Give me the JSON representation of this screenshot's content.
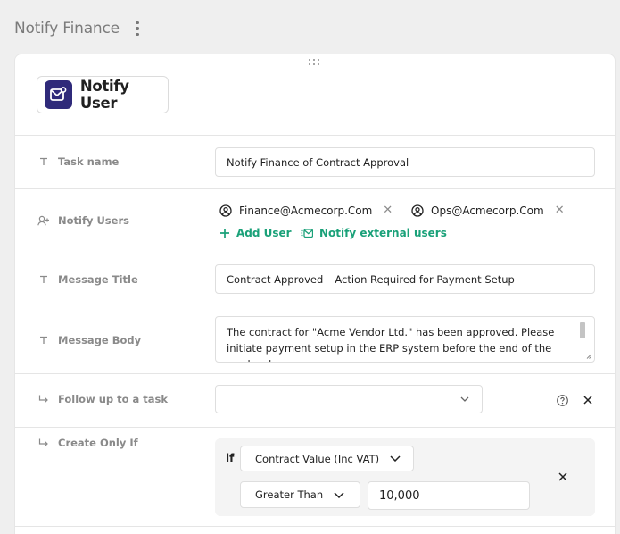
{
  "page": {
    "title": "Notify Finance"
  },
  "task": {
    "type_label": "Notify User"
  },
  "fields": {
    "task_name": {
      "label": "Task name",
      "value": "Notify Finance of Contract Approval"
    },
    "notify_users": {
      "label": "Notify Users",
      "users": [
        "Finance@Acmecorp.Com",
        "Ops@Acmecorp.Com"
      ],
      "add_user_label": "Add User",
      "notify_external_label": "Notify external users"
    },
    "message_title": {
      "label": "Message Title",
      "value": "Contract Approved – Action Required for Payment Setup"
    },
    "message_body": {
      "label": "Message Body",
      "value": "The contract for \"Acme Vendor Ltd.\" has been approved. Please initiate payment setup in the ERP system before the end of the week. <br>"
    },
    "follow_up": {
      "label": "Follow up to a task",
      "value": ""
    },
    "create_only_if": {
      "label": "Create Only If",
      "if_label": "if",
      "field": "Contract Value (Inc VAT)",
      "operator": "Greater Than",
      "value": "10,000"
    }
  },
  "colors": {
    "accent_green": "#1aa179",
    "badge_bg": "#2f2a7a",
    "label_gray": "#8a8a8a"
  },
  "icons": {
    "kebab": "more-vertical-icon",
    "task_badge": "mail-notify-icon",
    "text_field": "text-type-icon",
    "users": "user-plus-icon",
    "follow": "return-arrow-icon",
    "user_chip": "user-circle-icon",
    "remove": "close-icon",
    "add": "plus-icon",
    "external": "mail-external-icon",
    "help": "help-circle-icon",
    "chevron": "chevron-down-icon"
  }
}
